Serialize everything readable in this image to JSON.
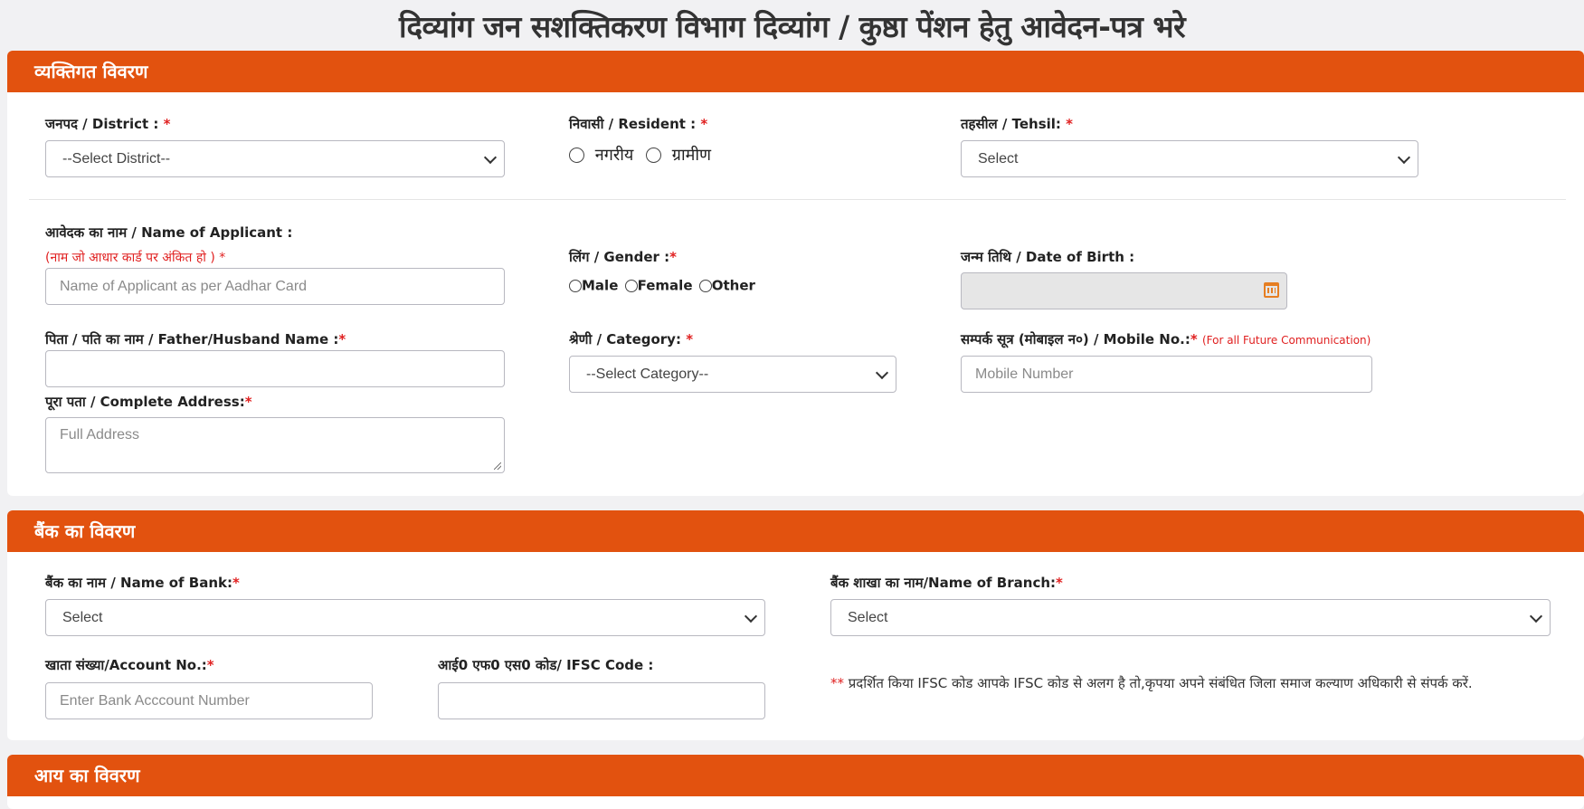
{
  "page_title": "दिव्यांग जन सशक्तिकरण विभाग दिव्यांग / कुष्ठा पेंशन हेतु आवेदन-पत्र भरे",
  "personal": {
    "header": "व्यक्तिगत विवरण",
    "district_label": "जनपद / District : ",
    "district_value": "--Select District--",
    "resident_label": "निवासी / Resident : ",
    "resident_urban": "नगरीय",
    "resident_rural": "ग्रामीण",
    "tehsil_label": "तहसील / Tehsil: ",
    "tehsil_value": "Select",
    "applicant_label": "आवेदक का नाम / Name of Applicant :",
    "applicant_hint": "(नाम जो आधार कार्ड पर अंकित हो ) ",
    "applicant_placeholder": "Name of Applicant as per Aadhar Card",
    "gender_label": "लिंग / Gender :",
    "gender_male": "Male",
    "gender_female": "Female",
    "gender_other": "Other",
    "dob_label": "जन्म तिथि / Date of Birth :",
    "father_label": "पिता / पति का नाम / Father/Husband Name :",
    "category_label": "श्रेणी / Category: ",
    "category_value": "--Select Category--",
    "mobile_label": "सम्पर्क सूत्र (मोबाइल न०) / Mobile No.:",
    "mobile_note": "(For all Future Communication)",
    "mobile_placeholder": "Mobile Number",
    "address_label": "पूरा पता / Complete Address:",
    "address_placeholder": "Full Address",
    "required_mark": "*"
  },
  "bank": {
    "header": "बैंक का विवरण",
    "bank_name_label": "बैंक का नाम / Name of Bank:",
    "bank_name_value": "Select",
    "branch_label": "बैंक शाखा का नाम/Name of Branch:",
    "branch_value": "Select",
    "account_label": "खाता संख्या/Account No.:",
    "account_placeholder": "Enter Bank Acccount Number",
    "ifsc_label": "आई0 एफ0 एस0 कोड/ IFSC Code :",
    "note_stars": "**",
    "note_text": " प्रदर्शित किया IFSC कोड आपके IFSC कोड से अलग है तो,कृपया अपने संबंधित जिला समाज कल्याण अधिकारी से संपर्क करें."
  },
  "income": {
    "header": "आय का विवरण"
  }
}
